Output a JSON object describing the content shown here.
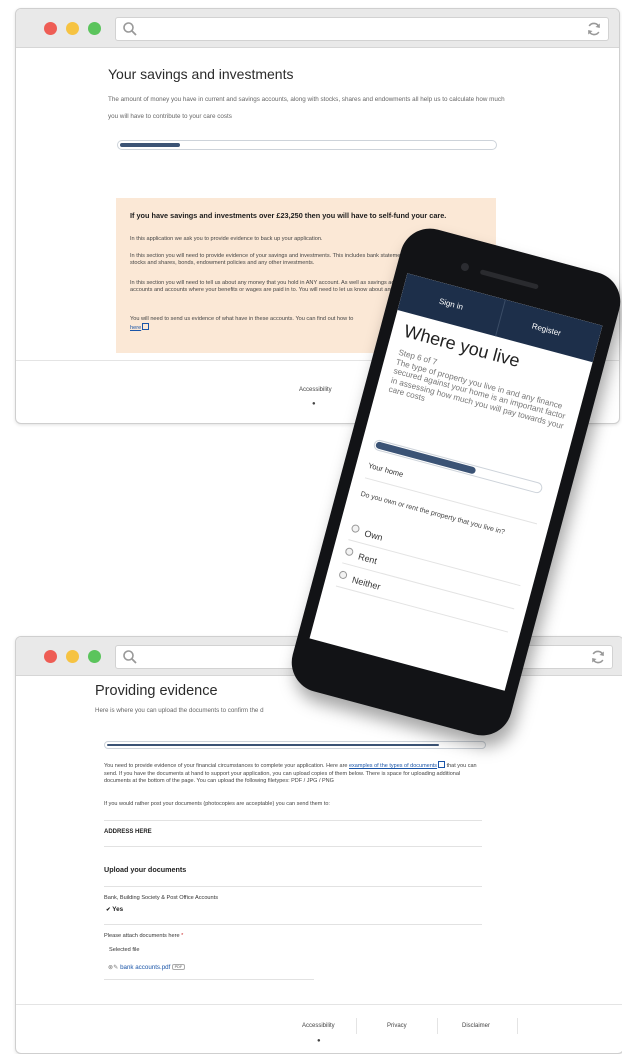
{
  "window1": {
    "heading": "Your savings and investments",
    "lead": "The amount of money you have in current and savings accounts, along with stocks, shares and endowments all help us to calculate how much you will have to contribute to your care costs",
    "progress": 0.16,
    "warning": {
      "heading": "If you have savings and investments over £23,250 then you will have to self-fund your care.",
      "p1": "In this application we ask you to provide evidence to back up your application.",
      "p2": "In this section you will need to provide evidence of your savings and investments. This includes bank statements and documents relating to stocks and shares, bonds, endowment policies and any other investments.",
      "p3": "In this section you will need to tell us about any money that you hold in ANY account. As well as savings accounts, this also means post office accounts and accounts where your benefits or wages are paid in to. You will need to let us know about any investments that you have.",
      "p4": "You will need to send us evidence of what have in these accounts. You can find out how to",
      "p4_link": "here"
    },
    "footer": {
      "accessibility": "Accessibility"
    }
  },
  "phone": {
    "nav": {
      "sign_in": "Sign in",
      "register": "Register"
    },
    "title": "Where you live",
    "step": "Step 6 of 7",
    "description": "The type of property you live in and any finance secured against your home is an important factor in assessing how much you will pay towards your care costs",
    "progress": 0.6,
    "section": "Your home",
    "question": "Do you own or rent the property that you live in?",
    "options": [
      "Own",
      "Rent",
      "Neither"
    ]
  },
  "window2": {
    "heading": "Providing evidence",
    "lead": "Here is where you can upload the documents to confirm the d",
    "progress": 0.88,
    "intro_before": "You need to provide evidence of your financial circumstances to complete your application. Here are",
    "intro_link": "examples of the types of documents",
    "intro_after": "that you can send. If you have the documents at hand to support your application, you can upload copies of them below. There is space for uploading additional documents at the bottom of the page. You can upload the following filetypes: PDF / JPG / PNG",
    "post_text": "If you would rather post your documents (photocopies are acceptable) you can send them to:",
    "address": "ADDRESS HERE",
    "upload_heading": "Upload your documents",
    "account_label": "Bank, Building Society & Post Office Accounts",
    "account_value": "Yes",
    "attach_label": "Please attach documents here",
    "required_mark": "*",
    "selected_file_label": "Selected file",
    "file_name": "bank accounts.pdf",
    "file_badge": "PDF",
    "footer": {
      "accessibility": "Accessibility",
      "privacy": "Privacy",
      "disclaimer": "Disclaimer"
    }
  },
  "colors": {
    "accent": "#3b5375",
    "nav": "#1d2f4a",
    "warning_bg": "#fbe8d6",
    "link": "#1a55a8"
  },
  "icons": [
    "search-icon",
    "refresh-icon",
    "eye-icon",
    "external-link-icon",
    "remove-icon",
    "attachment-icon"
  ]
}
